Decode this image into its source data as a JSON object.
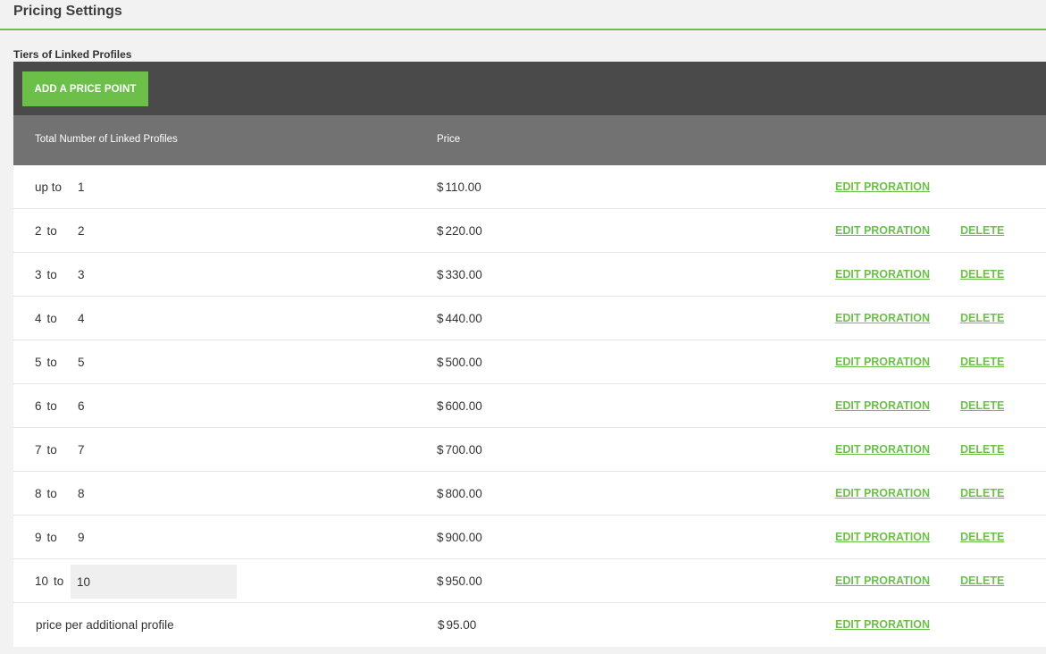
{
  "page": {
    "title": "Pricing Settings",
    "section_title": "Tiers of Linked Profiles"
  },
  "toolbar": {
    "add_label": "ADD A PRICE POINT"
  },
  "table": {
    "headers": {
      "profiles": "Total Number of Linked Profiles",
      "price": "Price"
    },
    "currency_symbol": "$",
    "edit_label": "EDIT PRORATION",
    "delete_label": "DELETE",
    "rows": [
      {
        "from": "up to",
        "to": "1",
        "price": "110.00",
        "deletable": false,
        "editable_input": false
      },
      {
        "from": "2",
        "to": "2",
        "price": "220.00",
        "deletable": true,
        "editable_input": false
      },
      {
        "from": "3",
        "to": "3",
        "price": "330.00",
        "deletable": true,
        "editable_input": false
      },
      {
        "from": "4",
        "to": "4",
        "price": "440.00",
        "deletable": true,
        "editable_input": false
      },
      {
        "from": "5",
        "to": "5",
        "price": "500.00",
        "deletable": true,
        "editable_input": false
      },
      {
        "from": "6",
        "to": "6",
        "price": "600.00",
        "deletable": true,
        "editable_input": false
      },
      {
        "from": "7",
        "to": "7",
        "price": "700.00",
        "deletable": true,
        "editable_input": false
      },
      {
        "from": "8",
        "to": "8",
        "price": "800.00",
        "deletable": true,
        "editable_input": false
      },
      {
        "from": "9",
        "to": "9",
        "price": "900.00",
        "deletable": true,
        "editable_input": false
      },
      {
        "from": "10",
        "to": "10",
        "price": "950.00",
        "deletable": true,
        "editable_input": true
      }
    ],
    "to_word": "to",
    "additional": {
      "label": "price per additional profile",
      "price": "95.00"
    }
  },
  "colors": {
    "accent": "#6cc04a",
    "toolbar_bg": "#4a4a4a",
    "header_bg": "#727272"
  }
}
